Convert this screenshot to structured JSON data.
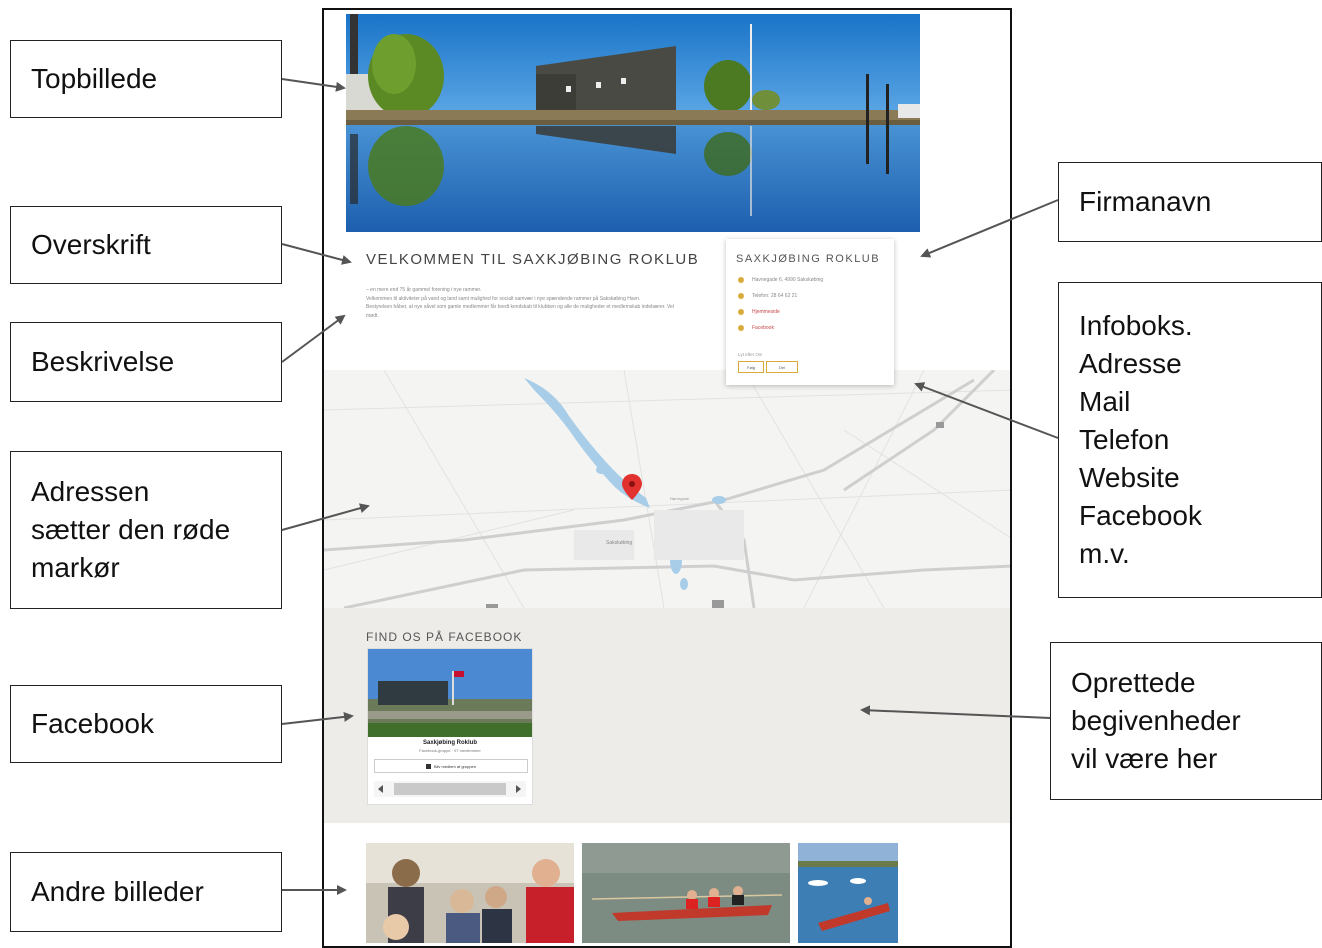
{
  "annotations": {
    "topbillede": "Topbillede",
    "overskrift": "Overskrift",
    "beskrivelse": "Beskrivelse",
    "adressen": "Adressen\nsætter den røde\nmarkør",
    "facebook": "Facebook",
    "andre_billeder": "Andre billeder",
    "firmanavn": "Firmanavn",
    "infoboks": "Infoboks.\nAdresse\nMail\nTelefon\nWebsite\nFacebook\nm.v.",
    "oprettede": "Oprettede\nbegivenheder\nvil være her"
  },
  "site": {
    "heading": "VELKOMMEN TIL SAXKJØBING ROKLUB",
    "description": [
      "– en mere end 75 år gammel forening i nye rammer.",
      "Velkommen til aktiviteter på vand og land samt mulighed for socialt samvær i nye spændende rammer på Sakskøbing Havn.",
      "Bestyrelsen håber, at nye såvel som gamle medlemmer får bredt kendskab til klubben og alle de muligheder et medlemskab indebærer. Vel mødt."
    ],
    "infobox": {
      "name": "SAXKJØBING ROKLUB",
      "address": "Havnegade 6, 4990 Sakskøbing",
      "phone": "Telefon: 28 64 62 21",
      "website": "Hjemmeside",
      "facebook": "Facebook",
      "follow": "Lyt efter Os!",
      "btn1": "Følg",
      "btn2": "Del"
    },
    "map": {
      "town": "Sakskøbing",
      "road": "Nørregade"
    },
    "facebook_section": {
      "title": "FIND OS PÅ FACEBOOK",
      "page_name": "Saxkjøbing Roklub",
      "page_sub": "Facebook-gruppe · 97 medlemmer",
      "join": "Bliv medlem af gruppen"
    }
  },
  "colors": {
    "accent": "#d7ac3a",
    "link": "#c54848",
    "marker": "#e2322f",
    "water": "#a7cde8",
    "sky": "#1e7fd0"
  }
}
